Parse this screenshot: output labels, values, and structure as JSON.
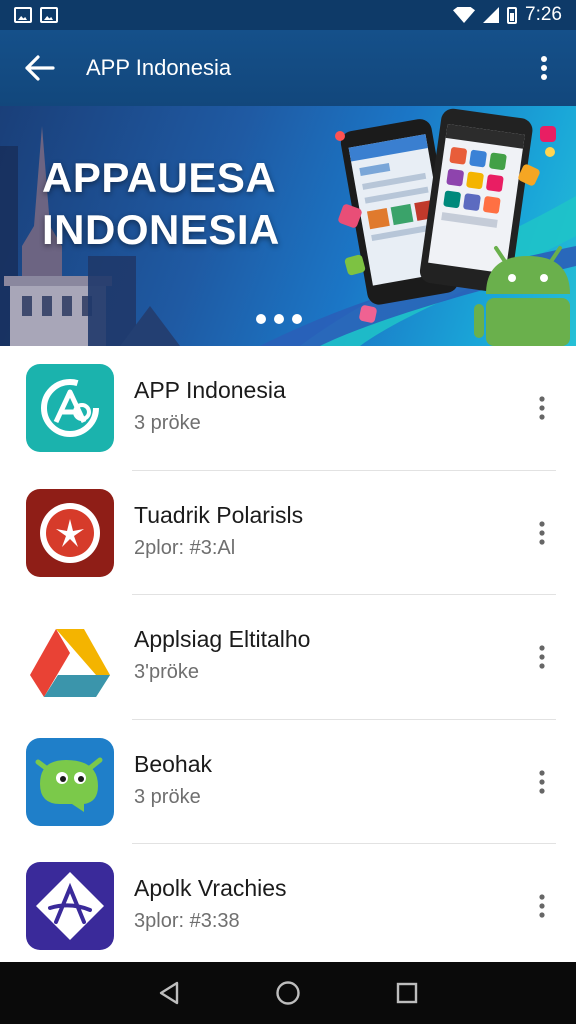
{
  "status_bar": {
    "time": "7:26",
    "left_icons": [
      "image-notification-icon",
      "image-notification-icon"
    ],
    "right_icons": [
      "wifi-icon",
      "signal-icon",
      "battery-icon"
    ]
  },
  "app_bar": {
    "title": "APP Indonesia",
    "back_icon": "arrow-left-icon",
    "menu_icon": "more-vert-icon"
  },
  "banner": {
    "line1": "APPAUESA",
    "line2": "INDONESIA",
    "pager": {
      "count": 3
    }
  },
  "apps": [
    {
      "name": "APP Indonesia",
      "subtitle": "3 pröke",
      "icon": "teal-a-logo-icon",
      "color": "#1bb3ad"
    },
    {
      "name": "Tuadrik Polarisls",
      "subtitle": "2plor: #3:Al",
      "icon": "red-star-logo-icon",
      "color": "#8f1e17"
    },
    {
      "name": "Applsiag Eltitalho",
      "subtitle": "3'pröke",
      "icon": "triangle-drive-logo-icon",
      "color": "#f4b400"
    },
    {
      "name": "Beohak",
      "subtitle": "3 pröke",
      "icon": "green-mascot-logo-icon",
      "color": "#1f7fc9"
    },
    {
      "name": "Apolk Vrachies",
      "subtitle": "3plor: #3:38",
      "icon": "purple-diamond-logo-icon",
      "color": "#3a2a9a"
    }
  ],
  "nav_bar": {
    "buttons": [
      "back-triangle-icon",
      "home-circle-icon",
      "recents-square-icon"
    ]
  },
  "colors": {
    "status_bar": "#0e3a68",
    "app_bar": "#15508a",
    "nav_bar": "#0a0a0a"
  }
}
